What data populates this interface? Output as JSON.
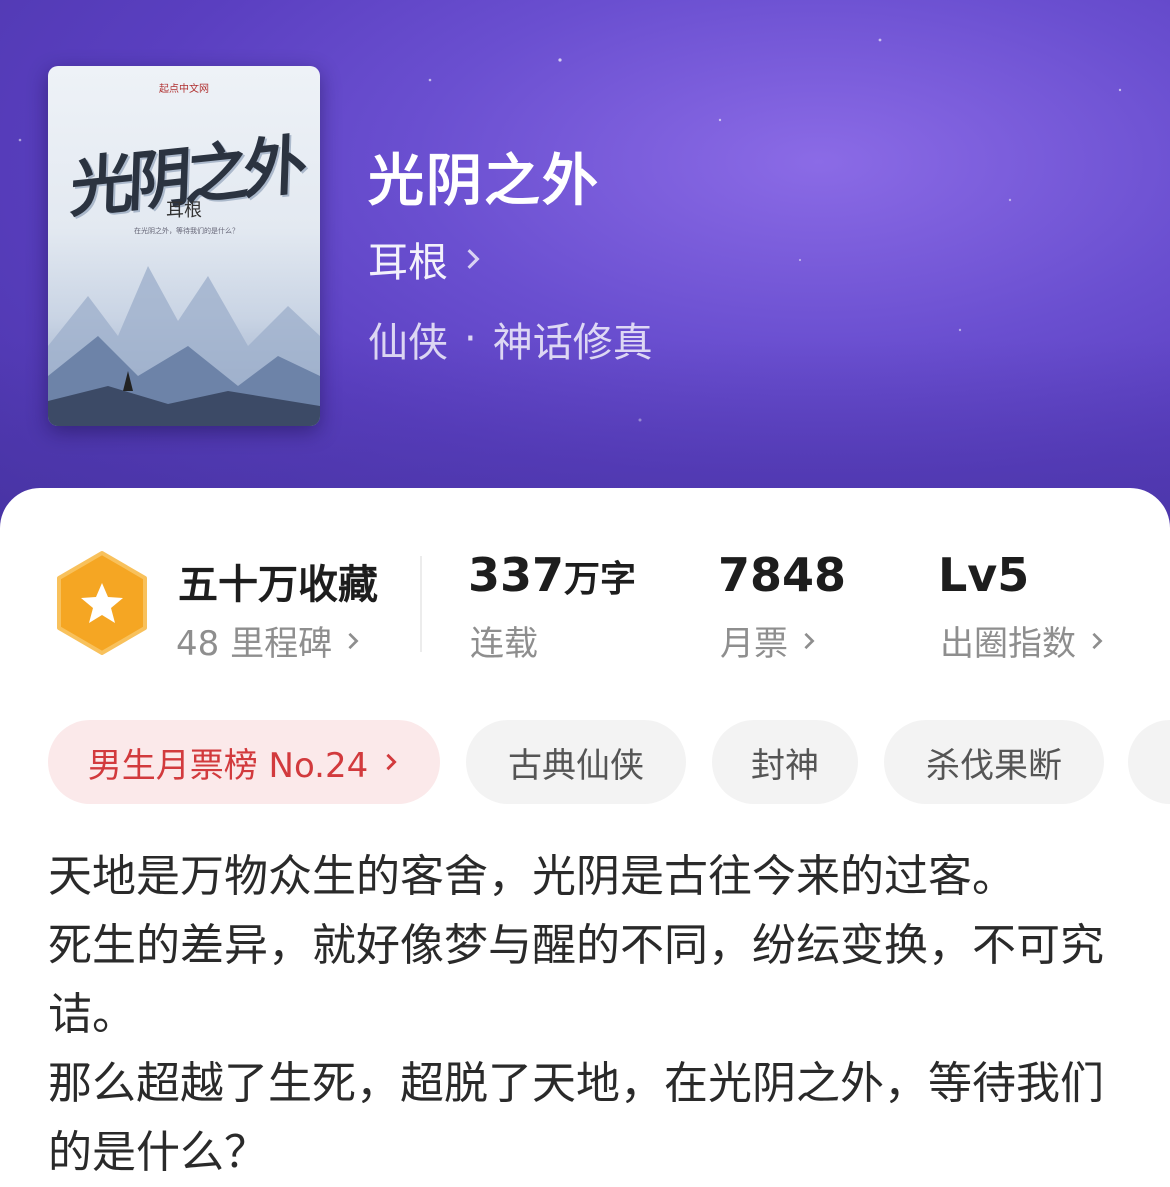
{
  "book": {
    "title": "光阴之外",
    "author": "耳根",
    "genre_primary": "仙侠",
    "genre_separator": "·",
    "genre_secondary": "神话修真"
  },
  "cover": {
    "publisher": "起点中文网",
    "title": "光阴之外",
    "author": "耳根",
    "tagline": "在光阴之外，等待我们的是什么？"
  },
  "stats": {
    "collection": {
      "value": "五十万收藏",
      "sub": "48 里程碑"
    },
    "words": {
      "value": "337",
      "unit": "万字",
      "sub": "连载"
    },
    "tickets": {
      "value": "7848",
      "sub": "月票"
    },
    "level": {
      "value": "Lv5",
      "sub": "出圈指数"
    }
  },
  "tags": {
    "rank": "男生月票榜 No.24",
    "items": [
      "古典仙侠",
      "封神",
      "杀伐果断"
    ]
  },
  "description": [
    "天地是万物众生的客舍，光阴是古往今来的过客。",
    "死生的差异，就好像梦与醒的不同，纷纭变换，不可究诘。",
    "那么超越了生死，超脱了天地，在光阴之外，等待我们的是什么？"
  ],
  "colors": {
    "hero_purple": "#5a3fc0",
    "badge_orange": "#f5a623",
    "rank_red": "#d23a3d",
    "rank_bg": "#fbe9ea"
  },
  "icons": {
    "badge": "star-badge-icon",
    "chevron": "chevron-right-icon"
  }
}
